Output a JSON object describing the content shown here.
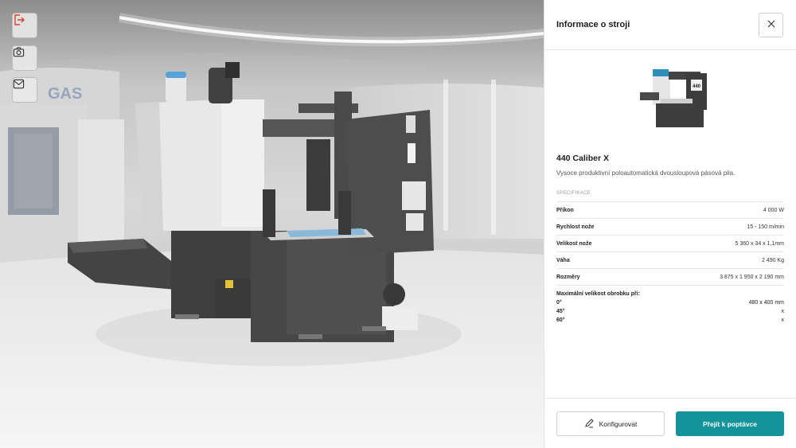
{
  "scene": {
    "tools": [
      {
        "name": "exit-icon",
        "tooltip": ""
      },
      {
        "name": "camera-icon",
        "tooltip": ""
      },
      {
        "name": "mail-icon",
        "tooltip": ""
      }
    ],
    "logo_text": "GAS",
    "machine_badge": "440"
  },
  "panel": {
    "title": "Informace o stroji",
    "machine_name": "440 Caliber X",
    "description": "Vysoce produktivní poloautomatická dvousloupová pásová pila.",
    "spec_heading": "SPECIFIKACE",
    "specs": [
      {
        "label": "Příkon",
        "value": "4 000 W"
      },
      {
        "label": "Rychlost nože",
        "value": "15 - 150 m/min"
      },
      {
        "label": "Velikost nože",
        "value": "5 360 x 34 x 1,1mm"
      },
      {
        "label": "Váha",
        "value": "2 490 Kg"
      },
      {
        "label": "Rozměry",
        "value": "3 875 x 1 950 x 2 190 mm"
      }
    ],
    "max_size": {
      "title": "Maximální velikost obrobku při:",
      "rows": [
        {
          "angle": "0°",
          "value": "480 x 400 mm"
        },
        {
          "angle": "45°",
          "value": "x"
        },
        {
          "angle": "60°",
          "value": "x"
        }
      ]
    },
    "buttons": {
      "configure": "Konfigurovat",
      "quote": "Přejít k poptávce"
    }
  },
  "colors": {
    "accent": "#14939a",
    "exit_icon": "#d9412f",
    "machine_dark": "#4a4a4a",
    "machine_light": "#e9e9e9"
  }
}
